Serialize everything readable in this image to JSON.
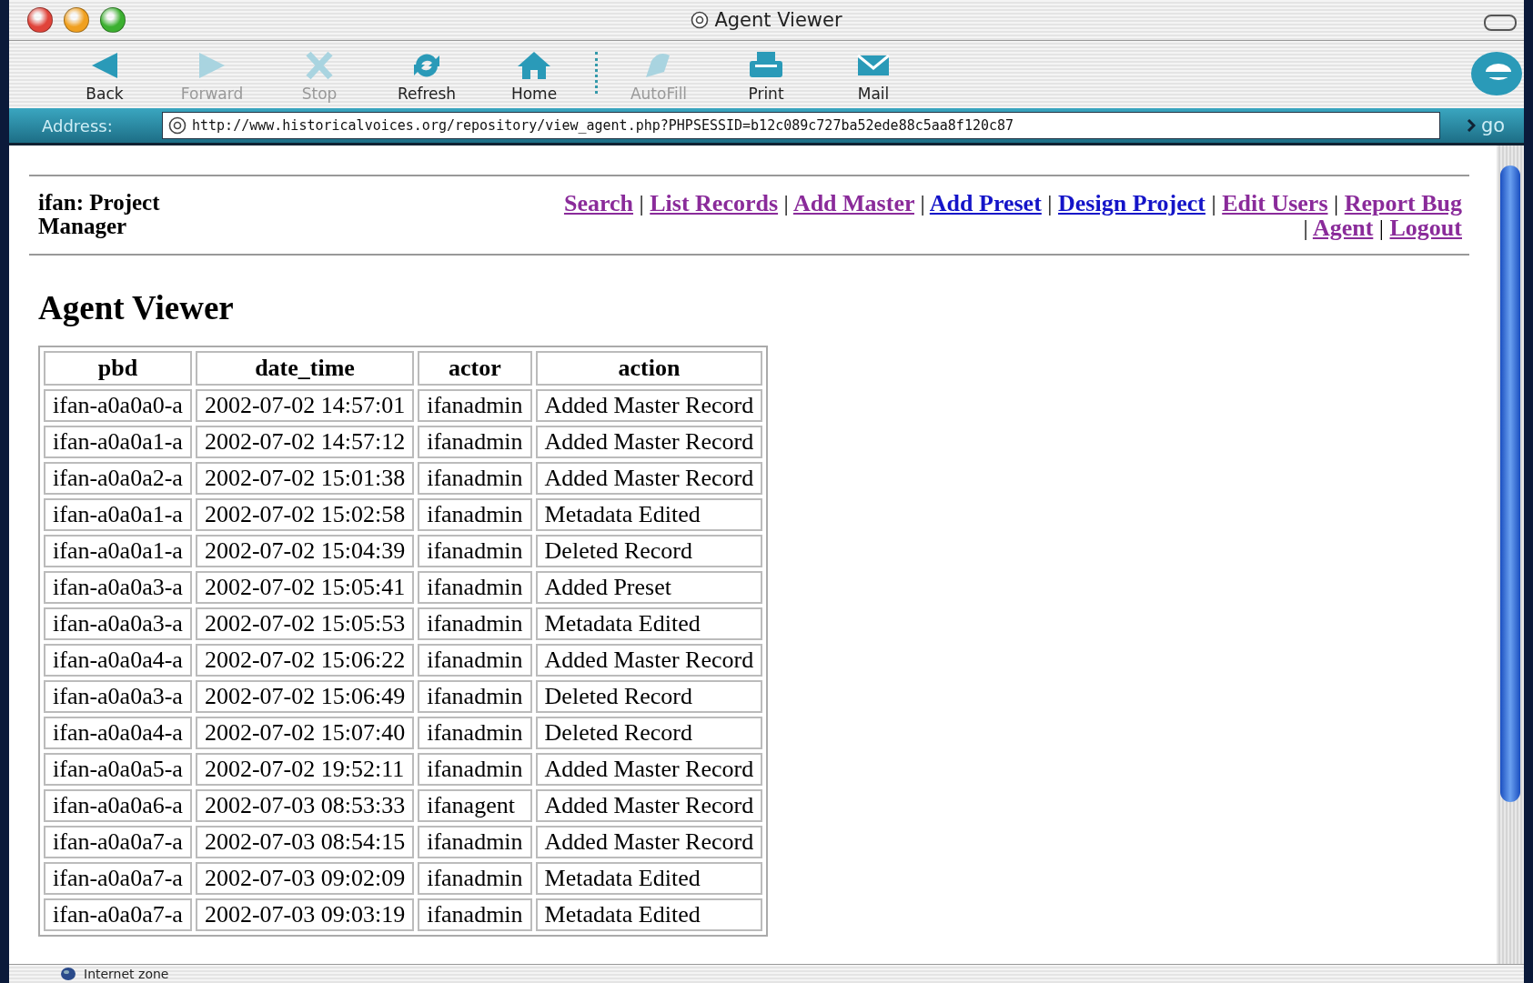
{
  "window": {
    "title": "Agent Viewer"
  },
  "toolbar": [
    {
      "label": "Back",
      "disabled": false
    },
    {
      "label": "Forward",
      "disabled": true
    },
    {
      "label": "Stop",
      "disabled": true
    },
    {
      "label": "Refresh",
      "disabled": false
    },
    {
      "label": "Home",
      "disabled": false
    },
    {
      "label": "AutoFill",
      "disabled": true,
      "separator_before": true
    },
    {
      "label": "Print",
      "disabled": false
    },
    {
      "label": "Mail",
      "disabled": false
    }
  ],
  "address_bar": {
    "label": "Address:",
    "value": "http://www.historicalvoices.org/repository/view_agent.php?PHPSESSID=b12c089c727ba52ede88c5aa8f120c87",
    "go": "go"
  },
  "page": {
    "user": "ifan: Project Manager",
    "nav_links": [
      {
        "label": "Search",
        "visited": true
      },
      {
        "label": "List Records",
        "visited": true,
        "separator": "|"
      },
      {
        "label": "Add Master",
        "visited": true,
        "separator": "|"
      },
      {
        "label": "Add Preset",
        "visited": false,
        "separator": "|"
      },
      {
        "label": "Design Project",
        "visited": false,
        "separator": "|"
      },
      {
        "label": "Edit Users",
        "visited": true,
        "separator": "|"
      },
      {
        "label": "Report Bug",
        "visited": true,
        "separator": "|"
      },
      {
        "label": "Agent",
        "visited": true,
        "separator": "|"
      },
      {
        "label": "Logout",
        "visited": true,
        "separator": "|"
      }
    ],
    "heading": "Agent Viewer",
    "table": {
      "columns": [
        "pbd",
        "date_time",
        "actor",
        "action"
      ],
      "rows": [
        [
          "ifan-a0a0a0-a",
          "2002-07-02 14:57:01",
          "ifanadmin",
          "Added Master Record"
        ],
        [
          "ifan-a0a0a1-a",
          "2002-07-02 14:57:12",
          "ifanadmin",
          "Added Master Record"
        ],
        [
          "ifan-a0a0a2-a",
          "2002-07-02 15:01:38",
          "ifanadmin",
          "Added Master Record"
        ],
        [
          "ifan-a0a0a1-a",
          "2002-07-02 15:02:58",
          "ifanadmin",
          "Metadata Edited"
        ],
        [
          "ifan-a0a0a1-a",
          "2002-07-02 15:04:39",
          "ifanadmin",
          "Deleted Record"
        ],
        [
          "ifan-a0a0a3-a",
          "2002-07-02 15:05:41",
          "ifanadmin",
          "Added Preset"
        ],
        [
          "ifan-a0a0a3-a",
          "2002-07-02 15:05:53",
          "ifanadmin",
          "Metadata Edited"
        ],
        [
          "ifan-a0a0a4-a",
          "2002-07-02 15:06:22",
          "ifanadmin",
          "Added Master Record"
        ],
        [
          "ifan-a0a0a3-a",
          "2002-07-02 15:06:49",
          "ifanadmin",
          "Deleted Record"
        ],
        [
          "ifan-a0a0a4-a",
          "2002-07-02 15:07:40",
          "ifanadmin",
          "Deleted Record"
        ],
        [
          "ifan-a0a0a5-a",
          "2002-07-02 19:52:11",
          "ifanadmin",
          "Added Master Record"
        ],
        [
          "ifan-a0a0a6-a",
          "2002-07-03 08:53:33",
          "ifanagent",
          "Added Master Record"
        ],
        [
          "ifan-a0a0a7-a",
          "2002-07-03 08:54:15",
          "ifanadmin",
          "Added Master Record"
        ],
        [
          "ifan-a0a0a7-a",
          "2002-07-03 09:02:09",
          "ifanadmin",
          "Metadata Edited"
        ],
        [
          "ifan-a0a0a7-a",
          "2002-07-03 09:03:19",
          "ifanadmin",
          "Metadata Edited"
        ]
      ]
    }
  },
  "status_bar": {
    "text": "Internet zone"
  }
}
